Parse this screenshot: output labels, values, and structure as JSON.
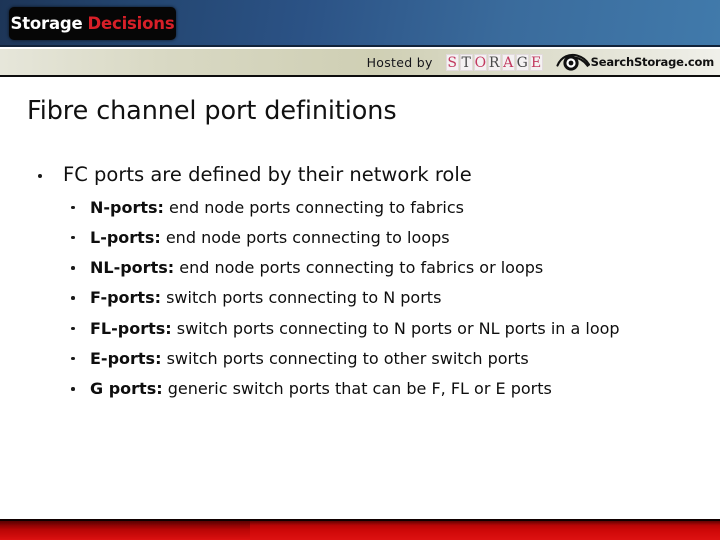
{
  "header": {
    "logo": {
      "word1": "Storage",
      "word2": "Decisions"
    },
    "hosted_by_label": "Hosted by",
    "storage_wordmark": "STORAGE",
    "storage_letters": [
      "S",
      "T",
      "O",
      "R",
      "A",
      "G",
      "E"
    ],
    "search_storage_text": "SearchStorage.com",
    "eye_icon_name": "eye-icon",
    "colors": {
      "band_dark_blue": "#1d3557",
      "band_light_blue": "#417aab",
      "beige": "#cfcfb4",
      "logo_red": "#d81f28",
      "storage_pink": "#c2395f",
      "storage_gray": "#4a4a4a"
    }
  },
  "slide": {
    "title": "Fibre channel port definitions",
    "bullet_level1": "FC ports are defined by their network role",
    "definitions": [
      {
        "term": "N-ports:",
        "desc": " end node ports connecting to fabrics"
      },
      {
        "term": "L-ports:",
        "desc": " end node ports connecting to loops"
      },
      {
        "term": "NL-ports:",
        "desc": " end node ports connecting to fabrics or loops"
      },
      {
        "term": "F-ports:",
        "desc": " switch ports connecting to N ports"
      },
      {
        "term": "FL-ports:",
        "desc": " switch ports connecting to N ports or NL ports in a loop"
      },
      {
        "term": "E-ports:",
        "desc": " switch ports connecting to other switch ports"
      },
      {
        "term": "G ports:",
        "desc": " generic switch ports that can be F, FL or E ports"
      }
    ]
  },
  "footer": {
    "accent_color": "#cf0808"
  }
}
